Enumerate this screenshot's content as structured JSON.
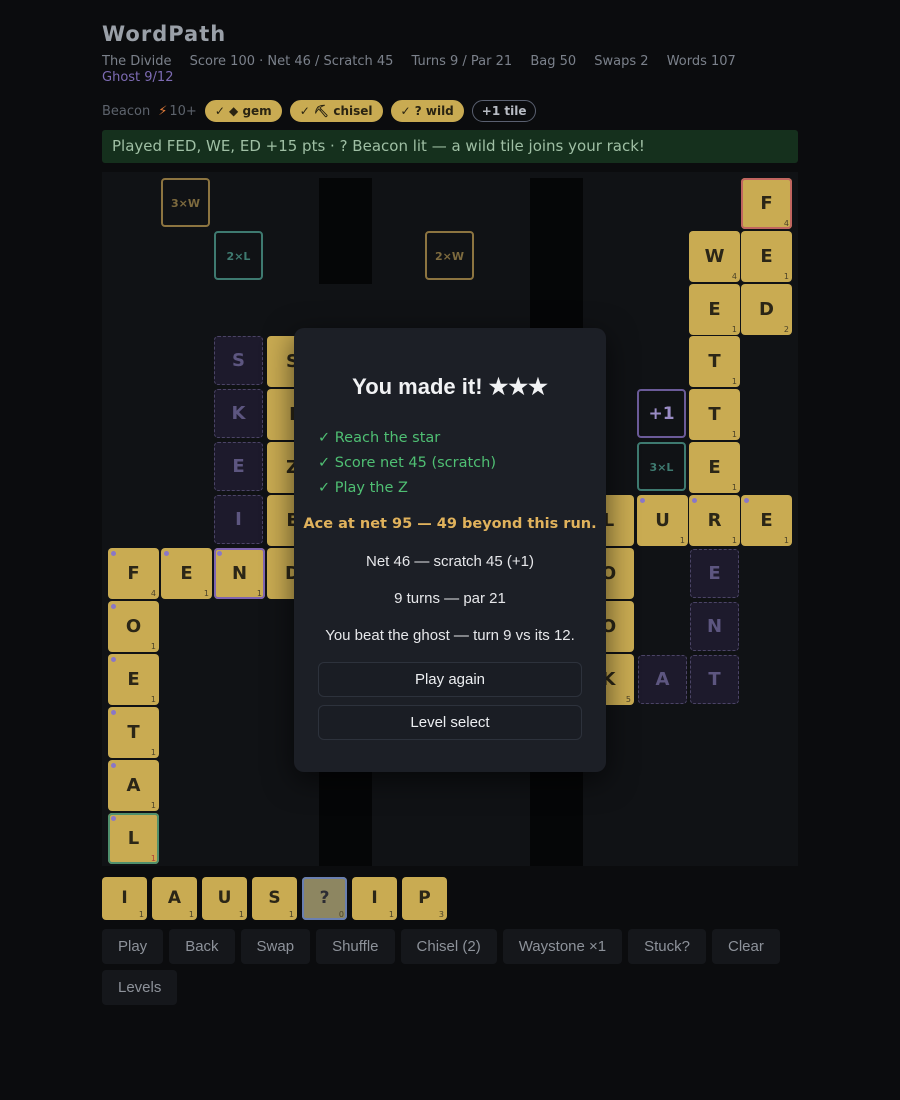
{
  "app_title": "WordPath",
  "stats": {
    "level": "The Divide",
    "score": "Score 100 · Net 46 / Scratch 45",
    "turns": "Turns 9 / Par 21",
    "bag": "Bag 50",
    "swaps": "Swaps 2",
    "words": "Words 107",
    "ghost": "Ghost 9/12"
  },
  "beacon": {
    "label": "Beacon",
    "bolt": "⚡",
    "threshold": "10+",
    "pills": [
      "✓ ◆ gem",
      "✓ ⛏ chisel",
      "✓ ? wild"
    ],
    "extra_pill": "+1 tile"
  },
  "banner": "Played FED, WE, ED +15 pts · ? Beacon lit — a wild tile joins your rack!",
  "board": {
    "bonuses": [
      "3×W",
      "2×L",
      "2×W",
      "+1",
      "3×L"
    ],
    "tiles": {
      "f_top": {
        "letter": "F",
        "num": "4"
      },
      "w": {
        "letter": "W",
        "num": "4"
      },
      "e1": {
        "letter": "E",
        "num": "1"
      },
      "e2": {
        "letter": "E",
        "num": "1"
      },
      "d": {
        "letter": "D",
        "num": "2"
      },
      "t1": {
        "letter": "T",
        "num": "1"
      },
      "t2": {
        "letter": "T",
        "num": "1"
      },
      "e3": {
        "letter": "E",
        "num": "1"
      },
      "s": {
        "letter": "S"
      },
      "i": {
        "letter": "I"
      },
      "z": {
        "letter": "Z"
      },
      "e4": {
        "letter": "E"
      },
      "l": {
        "letter": "L"
      },
      "u": {
        "letter": "U",
        "num": "1"
      },
      "r": {
        "letter": "R",
        "num": "1"
      },
      "e5": {
        "letter": "E",
        "num": "1"
      },
      "f2": {
        "letter": "F",
        "num": "4"
      },
      "e6": {
        "letter": "E",
        "num": "1"
      },
      "n": {
        "letter": "N",
        "num": "1"
      },
      "d2": {
        "letter": "D"
      },
      "o1": {
        "letter": "O"
      },
      "o2": {
        "letter": "O"
      },
      "k": {
        "letter": "K",
        "num": "5"
      },
      "col_o": {
        "letter": "O",
        "num": "1"
      },
      "col_e": {
        "letter": "E",
        "num": "1"
      },
      "col_t": {
        "letter": "T",
        "num": "1"
      },
      "col_a": {
        "letter": "A",
        "num": "1"
      },
      "col_l": {
        "letter": "L",
        "num": "1"
      }
    },
    "ghost_tiles": [
      "S",
      "K",
      "E",
      "I",
      "E",
      "N",
      "A",
      "T"
    ]
  },
  "rack": [
    {
      "letter": "I",
      "num": "1"
    },
    {
      "letter": "A",
      "num": "1"
    },
    {
      "letter": "U",
      "num": "1"
    },
    {
      "letter": "S",
      "num": "1"
    },
    {
      "letter": "?",
      "num": "0"
    },
    {
      "letter": "I",
      "num": "1"
    },
    {
      "letter": "P",
      "num": "3"
    }
  ],
  "controls": [
    "Play",
    "Back",
    "Swap",
    "Shuffle",
    "Chisel (2)",
    "Waystone ×1",
    "Stuck?",
    "Clear",
    "Levels"
  ],
  "modal": {
    "title": "You made it! ★★★",
    "goals": [
      "✓ Reach the star",
      "✓ Score net 45 (scratch)",
      "✓ Play the Z"
    ],
    "ace": "Ace at net 95 — 49 beyond this run.",
    "net_line": "Net 46 — scratch 45 (+1)",
    "turns_line": "9 turns — par 21",
    "ghost_line": "You beat the ghost — turn 9 vs its 12.",
    "play_again": "Play again",
    "level_select": "Level select"
  },
  "colors": {
    "tile": "#c9ab52",
    "ghost": "#1d1a2c",
    "goal_green": "#4fbf73",
    "ace_gold": "#e0b25c"
  }
}
